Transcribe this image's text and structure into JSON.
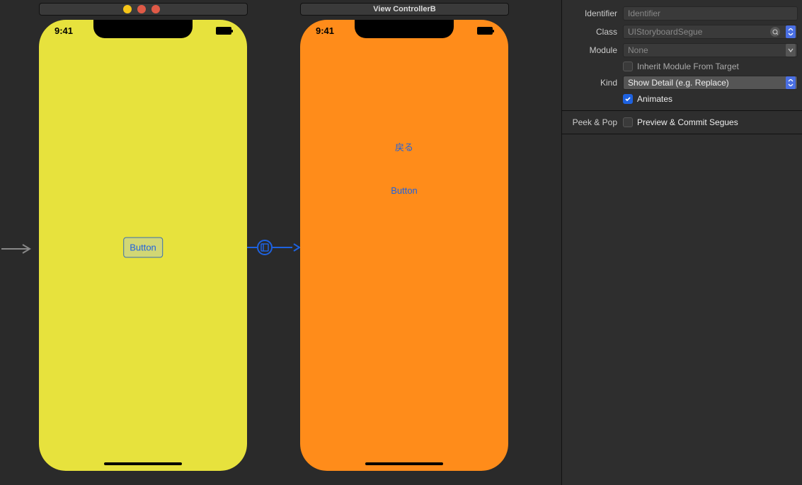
{
  "canvas": {
    "sceneA": {
      "titlebar": "",
      "time": "9:41",
      "button_label": "Button"
    },
    "sceneB": {
      "titlebar": "View ControllerB",
      "time": "9:41",
      "back_label": "戻る",
      "button_label": "Button"
    }
  },
  "inspector": {
    "identifier_label": "Identifier",
    "identifier_placeholder": "Identifier",
    "class_label": "Class",
    "class_value": "UIStoryboardSegue",
    "module_label": "Module",
    "module_value": "None",
    "inherit_label": "Inherit Module From Target",
    "inherit_checked": false,
    "kind_label": "Kind",
    "kind_value": "Show Detail (e.g. Replace)",
    "animates_label": "Animates",
    "animates_checked": true,
    "peekpop_label": "Peek & Pop",
    "preview_label": "Preview & Commit Segues",
    "preview_checked": false
  }
}
